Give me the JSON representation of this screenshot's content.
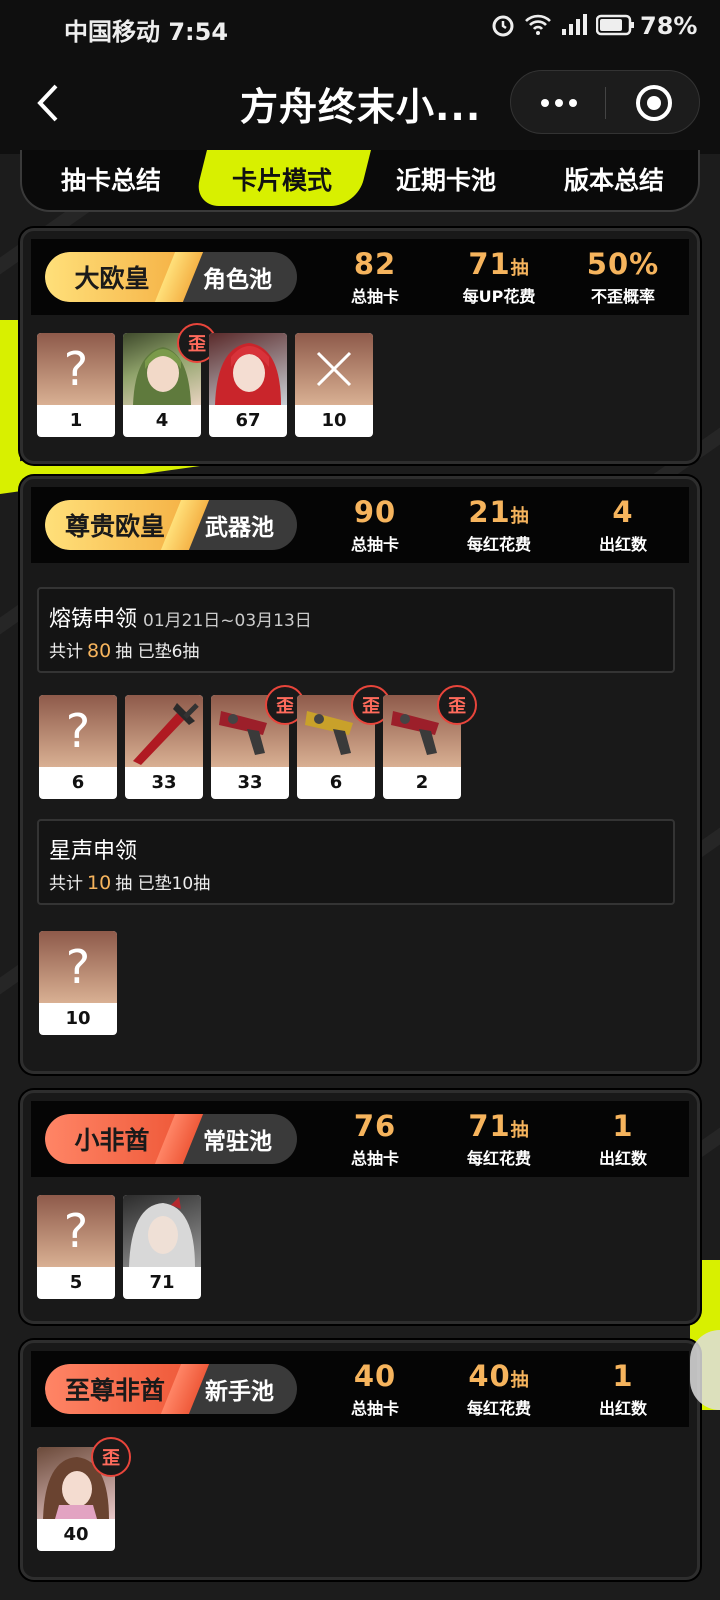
{
  "status": {
    "carrier_time": "中国移动 7:54",
    "battery": "78%"
  },
  "nav": {
    "title": "方舟终末小..."
  },
  "tabs": [
    "抽卡总结",
    "卡片模式",
    "近期卡池",
    "版本总结"
  ],
  "cards": [
    {
      "badge_rank": "大欧皇",
      "badge_pool": "角色池",
      "stats": [
        {
          "value": "82",
          "unit": "",
          "label": "总抽卡"
        },
        {
          "value": "71",
          "unit": "抽",
          "label": "每UP花费"
        },
        {
          "value": "50%",
          "unit": "",
          "label": "不歪概率"
        }
      ],
      "items": [
        {
          "num": "1",
          "type": "unknown",
          "wai": false
        },
        {
          "num": "4",
          "type": "char-green",
          "wai": true
        },
        {
          "num": "67",
          "type": "char-red",
          "wai": false
        },
        {
          "num": "10",
          "type": "cross",
          "wai": false
        }
      ]
    },
    {
      "badge_rank": "尊贵欧皇",
      "badge_pool": "武器池",
      "stats": [
        {
          "value": "90",
          "unit": "",
          "label": "总抽卡"
        },
        {
          "value": "21",
          "unit": "抽",
          "label": "每红花费"
        },
        {
          "value": "4",
          "unit": "",
          "label": "出红数"
        }
      ],
      "pools": [
        {
          "name": "熔铸申领",
          "date": "01月21日~03月13日",
          "sum_pre": "共计",
          "sum_count": "80",
          "sum_post": "抽  已垫6抽",
          "items": [
            {
              "num": "6",
              "type": "unknown",
              "wai": false
            },
            {
              "num": "33",
              "type": "sword",
              "wai": false
            },
            {
              "num": "33",
              "type": "gun-red",
              "wai": true
            },
            {
              "num": "6",
              "type": "gun-gold",
              "wai": true
            },
            {
              "num": "2",
              "type": "gun-red",
              "wai": true
            }
          ]
        },
        {
          "name": "星声申领",
          "date": "",
          "sum_pre": "共计",
          "sum_count": "10",
          "sum_post": "抽  已垫10抽",
          "items": [
            {
              "num": "10",
              "type": "unknown",
              "wai": false
            }
          ]
        }
      ]
    },
    {
      "badge_rank": "小非酋",
      "badge_pool": "常驻池",
      "stats": [
        {
          "value": "76",
          "unit": "",
          "label": "总抽卡"
        },
        {
          "value": "71",
          "unit": "抽",
          "label": "每红花费"
        },
        {
          "value": "1",
          "unit": "",
          "label": "出红数"
        }
      ],
      "items": [
        {
          "num": "5",
          "type": "unknown",
          "wai": false
        },
        {
          "num": "71",
          "type": "char-white",
          "wai": false
        }
      ]
    },
    {
      "badge_rank": "至尊非酋",
      "badge_pool": "新手池",
      "stats": [
        {
          "value": "40",
          "unit": "",
          "label": "总抽卡"
        },
        {
          "value": "40",
          "unit": "抽",
          "label": "每红花费"
        },
        {
          "value": "1",
          "unit": "",
          "label": "出红数"
        }
      ],
      "items": [
        {
          "num": "40",
          "type": "char-brown",
          "wai": true
        }
      ]
    }
  ],
  "wai_label": "歪",
  "colors": {
    "accent": "#d8f000",
    "stat": "#f6b45d",
    "wai": "#e8453b"
  }
}
